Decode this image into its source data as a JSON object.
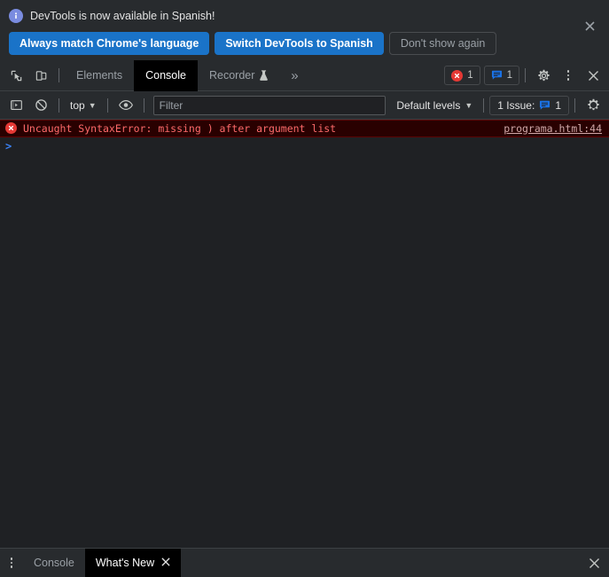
{
  "banner": {
    "icon": "info-icon",
    "message": "DevTools is now available in Spanish!",
    "buttons": {
      "primary_1": "Always match Chrome's language",
      "primary_2": "Switch DevTools to Spanish",
      "dismiss": "Don't show again"
    },
    "close_icon": "close-icon"
  },
  "main_toolbar": {
    "inspect_icon": "inspect-element-icon",
    "device_icon": "device-toolbar-icon",
    "tabs": [
      {
        "label": "Elements",
        "active": false,
        "icon": null
      },
      {
        "label": "Console",
        "active": true,
        "icon": null
      },
      {
        "label": "Recorder",
        "active": false,
        "icon": "experiment-flask-icon"
      }
    ],
    "more_tabs_icon": "chevron-double-right-icon",
    "error_badge": {
      "icon": "error-circle-icon",
      "count": "1",
      "color": "#e53935"
    },
    "message_badge": {
      "icon": "speech-bubble-icon",
      "count": "1",
      "color": "#1a73e8"
    },
    "settings_icon": "gear-icon",
    "kebab_icon": "more-options-icon",
    "close_icon": "close-icon"
  },
  "filter_bar": {
    "sidebar_toggle_icon": "console-sidebar-icon",
    "clear_console_icon": "clear-console-icon",
    "context_selector": {
      "value": "top",
      "caret": "▼"
    },
    "eye_icon": "live-expression-eye-icon",
    "filter": {
      "value": "",
      "placeholder": "Filter"
    },
    "levels_selector": {
      "value": "Default levels",
      "caret": "▼"
    },
    "issues_pill": {
      "label": "1 Issue:",
      "icon": "speech-bubble-icon",
      "count": "1"
    },
    "settings_icon": "gear-icon"
  },
  "console": {
    "messages": [
      {
        "level": "error",
        "icon": "error-circle-icon",
        "text": "Uncaught SyntaxError: missing ) after argument list",
        "source": "programa.html:44"
      }
    ],
    "prompt": ">"
  },
  "drawer": {
    "kebab_icon": "more-tools-icon",
    "tabs": [
      {
        "label": "Console",
        "active": false,
        "closable": false
      },
      {
        "label": "What's New",
        "active": true,
        "closable": true,
        "close_icon": "close-icon"
      }
    ],
    "close_icon": "close-icon"
  },
  "colors": {
    "accent_blue": "#1a73c8",
    "error_red": "#e53935",
    "error_text": "#fc6a6a",
    "error_bg": "#290000",
    "toolbar_bg": "#282b2e",
    "console_bg": "#1f2124",
    "active_tab_bg": "#000000"
  }
}
